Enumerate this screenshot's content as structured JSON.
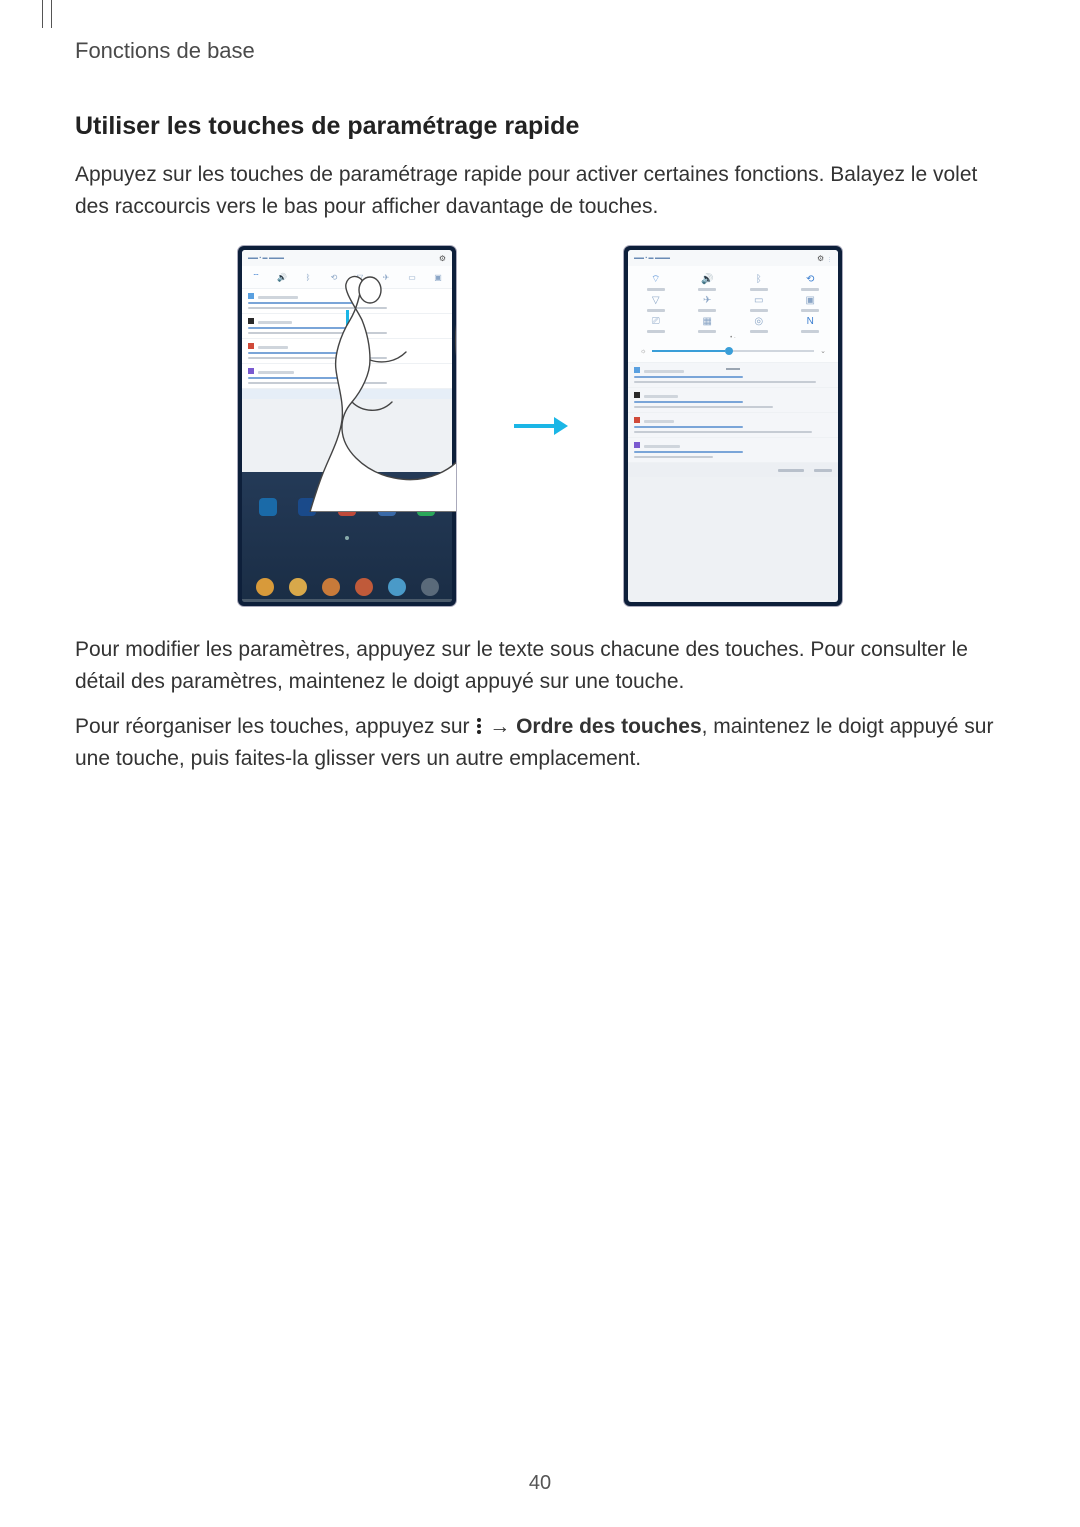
{
  "header": {
    "section_label": "Fonctions de base"
  },
  "section": {
    "title": "Utiliser les touches de paramétrage rapide",
    "intro": "Appuyez sur les touches de paramétrage rapide pour activer certaines fonctions. Balayez le volet des raccourcis vers le bas pour afficher davantage de touches.",
    "para2": "Pour modifier les paramètres, appuyez sur le texte sous chacune des touches. Pour consulter le détail des paramètres, maintenez le doigt appuyé sur une touche.",
    "para3_a": "Pour réorganiser les touches, appuyez sur ",
    "para3_arrow": " → ",
    "para3_bold": "Ordre des touches",
    "para3_b": ", maintenez le doigt appuyé sur une touche, puis faites-la glisser vers un autre emplacement."
  },
  "page_number": "40"
}
